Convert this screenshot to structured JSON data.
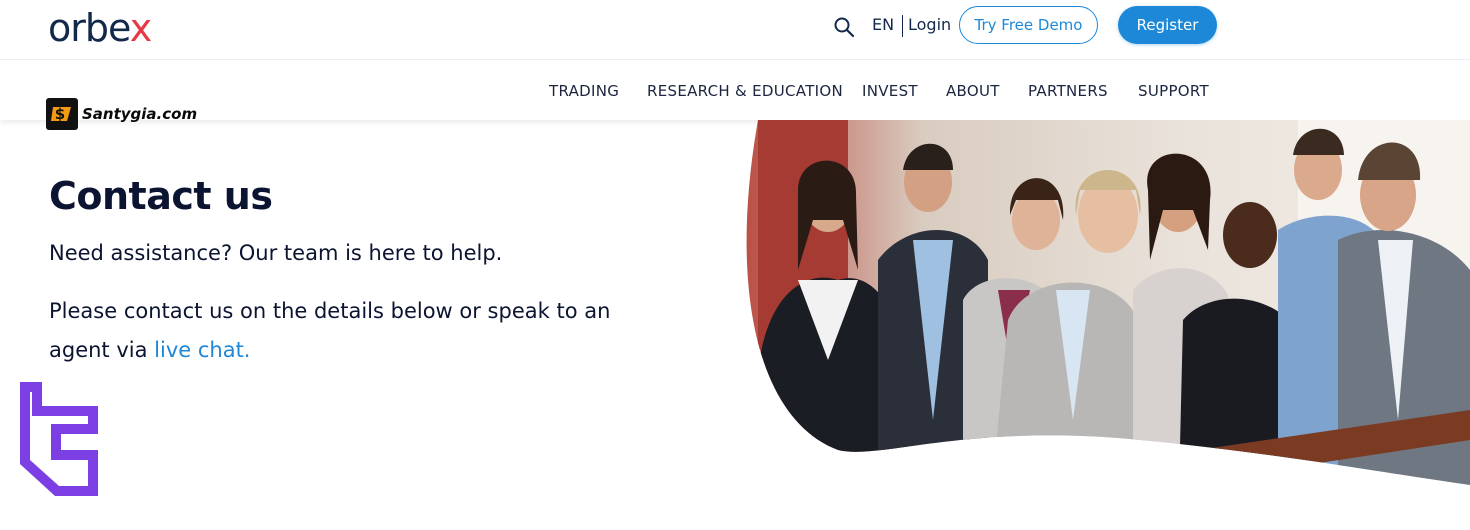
{
  "header": {
    "logo_main": "orbe",
    "logo_x": "x",
    "lang": "EN",
    "login": "Login",
    "demo_btn": "Try Free Demo",
    "register_btn": "Register"
  },
  "nav": {
    "items": [
      "TRADING",
      "RESEARCH & EDUCATION",
      "INVEST",
      "ABOUT",
      "PARTNERS",
      "SUPPORT"
    ]
  },
  "watermark": {
    "text": "Santygia.com"
  },
  "hero": {
    "title": "Contact us",
    "line1": "Need assistance? Our team is here to help.",
    "line2_prefix": "Please contact us on the details below or speak to an agent via ",
    "line2_link": "live chat."
  },
  "colors": {
    "accent": "#1e88d8",
    "brand_x": "#e63946",
    "mark": "#7b3fe4"
  },
  "icons": {
    "search": "search-icon",
    "mark": "brand-mark-icon"
  }
}
